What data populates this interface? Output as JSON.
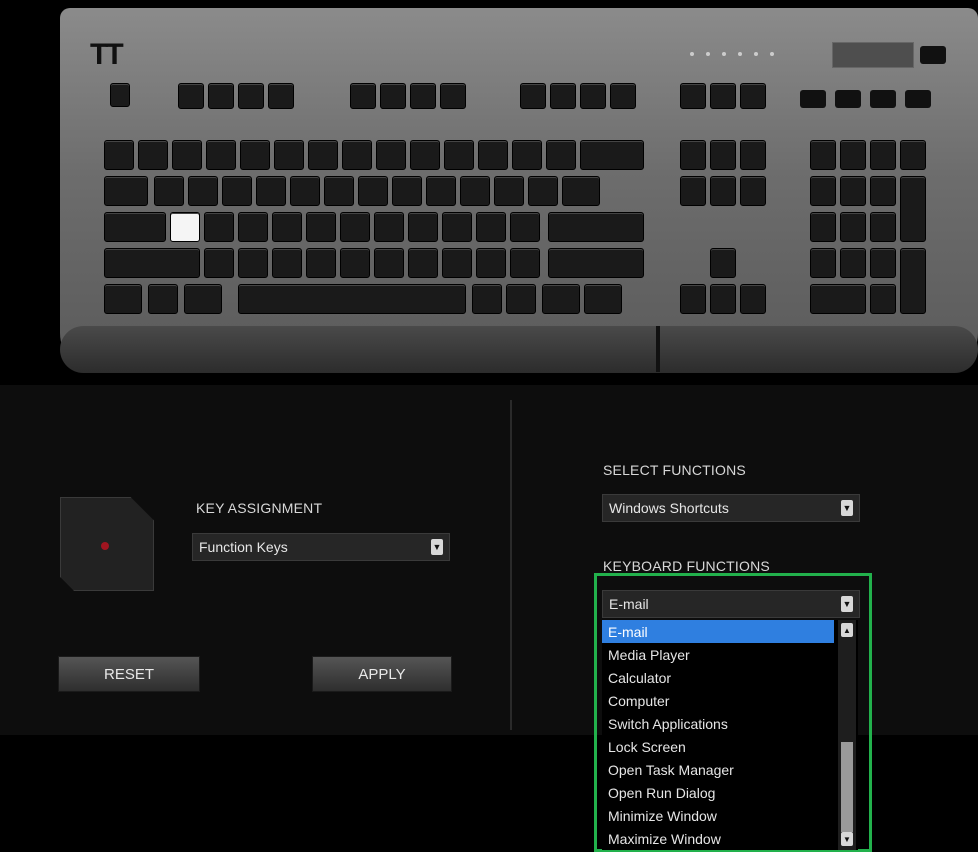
{
  "brand": {
    "logo_text": "TT"
  },
  "key_assignment": {
    "label": "KEY ASSIGNMENT",
    "selected": "Function Keys"
  },
  "select_functions": {
    "label": "SELECT FUNCTIONS",
    "selected": "Windows Shortcuts"
  },
  "keyboard_functions": {
    "label": "KEYBOARD FUNCTIONS",
    "selected": "E-mail",
    "options": [
      "E-mail",
      "Media Player",
      "Calculator",
      "Computer",
      "Switch Applications",
      "Lock Screen",
      "Open Task Manager",
      "Open Run Dialog",
      "Minimize Window",
      "Maximize Window"
    ],
    "highlighted_index": 0
  },
  "buttons": {
    "reset": "RESET",
    "apply": "APPLY"
  },
  "colors": {
    "highlight_box": "#22b14c",
    "list_selection": "#2f7fe0",
    "preview_dot": "#a01520"
  }
}
